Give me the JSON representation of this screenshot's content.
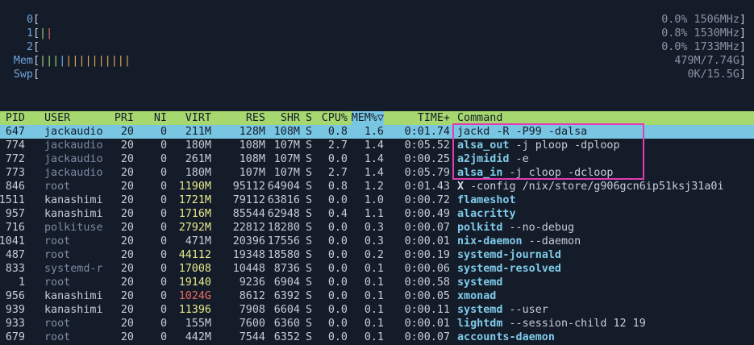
{
  "meters": [
    {
      "label": "0",
      "bars": "",
      "value": "0.0% 1506MHz"
    },
    {
      "label": "1",
      "bars": "||",
      "value": "0.8% 1530MHz"
    },
    {
      "label": "2",
      "bars": "",
      "value": "0.0% 1733MHz"
    },
    {
      "label": "Mem",
      "bars": "||||||||||||||",
      "value": "479M/7.74G"
    },
    {
      "label": "Swp",
      "bars": "",
      "value": "0K/15.5G"
    }
  ],
  "brackets": {
    "open": "[",
    "close": "]"
  },
  "header": {
    "pid": "PID",
    "user": "USER",
    "pri": "PRI",
    "ni": "NI",
    "virt": "VIRT",
    "res": "RES",
    "shr": "SHR",
    "s": "S",
    "cpu": "CPU%",
    "mem": "MEM%▽",
    "time": "TIME+",
    "command": "Command"
  },
  "processes": [
    {
      "pid": "647",
      "user": "jackaudio",
      "pri": "20",
      "ni": "0",
      "virt": "211M",
      "res": "128M",
      "shr": "108M",
      "s": "S",
      "cpu": "0.8",
      "mem": "1.6",
      "time": "0:01.74",
      "cmd": "jackd",
      "args": " -R -P99 -dalsa"
    },
    {
      "pid": "774",
      "user": "jackaudio",
      "pri": "20",
      "ni": "0",
      "virt": "180M",
      "res": "108M",
      "shr": "107M",
      "s": "S",
      "cpu": "2.7",
      "mem": "1.4",
      "time": "0:05.52",
      "cmd": "alsa_out",
      "args": " -j ploop -dploop"
    },
    {
      "pid": "772",
      "user": "jackaudio",
      "pri": "20",
      "ni": "0",
      "virt": "261M",
      "res": "108M",
      "shr": "107M",
      "s": "S",
      "cpu": "0.0",
      "mem": "1.4",
      "time": "0:00.25",
      "cmd": "a2jmidid",
      "args": " -e"
    },
    {
      "pid": "773",
      "user": "jackaudio",
      "pri": "20",
      "ni": "0",
      "virt": "180M",
      "res": "107M",
      "shr": "107M",
      "s": "S",
      "cpu": "2.7",
      "mem": "1.4",
      "time": "0:05.79",
      "cmd": "alsa_in",
      "args": " -j cloop -dcloop"
    },
    {
      "pid": "846",
      "user": "root",
      "pri": "20",
      "ni": "0",
      "virt": "1190M",
      "res": "95112",
      "shr": "64904",
      "s": "S",
      "cpu": "0.8",
      "mem": "1.2",
      "time": "0:01.43",
      "cmd": "X",
      "args": " -config /nix/store/g906gcn6ip51ksj31a0i"
    },
    {
      "pid": "1511",
      "user": "kanashimi",
      "pri": "20",
      "ni": "0",
      "virt": "1721M",
      "res": "79112",
      "shr": "63816",
      "s": "S",
      "cpu": "0.0",
      "mem": "1.0",
      "time": "0:00.72",
      "cmd": "flameshot",
      "args": ""
    },
    {
      "pid": "957",
      "user": "kanashimi",
      "pri": "20",
      "ni": "0",
      "virt": "1716M",
      "res": "85544",
      "shr": "62948",
      "s": "S",
      "cpu": "0.4",
      "mem": "1.1",
      "time": "0:00.49",
      "cmd": "alacritty",
      "args": ""
    },
    {
      "pid": "716",
      "user": "polkituse",
      "pri": "20",
      "ni": "0",
      "virt": "2792M",
      "res": "22812",
      "shr": "18280",
      "s": "S",
      "cpu": "0.0",
      "mem": "0.3",
      "time": "0:00.07",
      "cmd": "polkitd",
      "args": " --no-debug"
    },
    {
      "pid": "1041",
      "user": "root",
      "pri": "20",
      "ni": "0",
      "virt": "471M",
      "res": "20396",
      "shr": "17556",
      "s": "S",
      "cpu": "0.0",
      "mem": "0.3",
      "time": "0:00.01",
      "cmd": "nix-daemon",
      "args": " --daemon"
    },
    {
      "pid": "487",
      "user": "root",
      "pri": "20",
      "ni": "0",
      "virt": "44112",
      "res": "19348",
      "shr": "18580",
      "s": "S",
      "cpu": "0.0",
      "mem": "0.2",
      "time": "0:00.19",
      "cmd": "systemd-journald",
      "args": ""
    },
    {
      "pid": "833",
      "user": "systemd-r",
      "pri": "20",
      "ni": "0",
      "virt": "17008",
      "res": "10448",
      "shr": "8736",
      "s": "S",
      "cpu": "0.0",
      "mem": "0.1",
      "time": "0:00.06",
      "cmd": "systemd-resolved",
      "args": ""
    },
    {
      "pid": "1",
      "user": "root",
      "pri": "20",
      "ni": "0",
      "virt": "19140",
      "res": "9236",
      "shr": "6904",
      "s": "S",
      "cpu": "0.0",
      "mem": "0.1",
      "time": "0:00.58",
      "cmd": "systemd",
      "args": ""
    },
    {
      "pid": "956",
      "user": "kanashimi",
      "pri": "20",
      "ni": "0",
      "virt": "1024G",
      "res": "8612",
      "shr": "6392",
      "s": "S",
      "cpu": "0.0",
      "mem": "0.1",
      "time": "0:00.05",
      "cmd": "xmonad",
      "args": ""
    },
    {
      "pid": "939",
      "user": "kanashimi",
      "pri": "20",
      "ni": "0",
      "virt": "11396",
      "res": "7908",
      "shr": "6604",
      "s": "S",
      "cpu": "0.0",
      "mem": "0.1",
      "time": "0:00.11",
      "cmd": "systemd",
      "args": " --user"
    },
    {
      "pid": "933",
      "user": "root",
      "pri": "20",
      "ni": "0",
      "virt": "155M",
      "res": "7600",
      "shr": "6360",
      "s": "S",
      "cpu": "0.0",
      "mem": "0.1",
      "time": "0:00.01",
      "cmd": "lightdm",
      "args": " --session-child 12 19"
    },
    {
      "pid": "679",
      "user": "root",
      "pri": "20",
      "ni": "0",
      "virt": "442M",
      "res": "7544",
      "shr": "6352",
      "s": "S",
      "cpu": "0.0",
      "mem": "0.1",
      "time": "0:00.07",
      "cmd": "accounts-daemon",
      "args": ""
    }
  ],
  "colors": {
    "header_bg": "#a6d86f",
    "selected_bg": "#79c6e3",
    "highlight_border": "#e23bb4",
    "bg": "#141c29"
  }
}
